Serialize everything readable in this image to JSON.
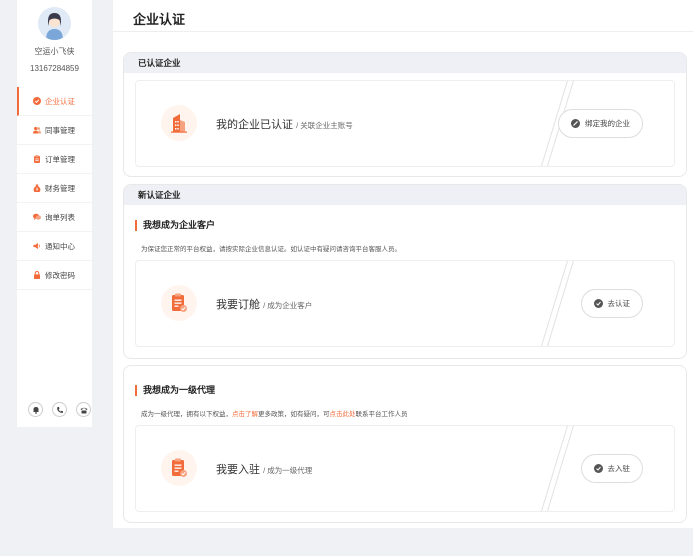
{
  "user": {
    "name": "空运小飞侠",
    "phone": "13167284859"
  },
  "menu": [
    {
      "label": "企业认证",
      "icon": "check-circle-icon",
      "active": true
    },
    {
      "label": "同事管理",
      "icon": "users-icon",
      "active": false
    },
    {
      "label": "订单管理",
      "icon": "clipboard-icon",
      "active": false
    },
    {
      "label": "财务管理",
      "icon": "money-bag-icon",
      "active": false
    },
    {
      "label": "询单列表",
      "icon": "chat-bubble-icon",
      "active": false
    },
    {
      "label": "通知中心",
      "icon": "megaphone-icon",
      "active": false
    },
    {
      "label": "修改密码",
      "icon": "lock-icon",
      "active": false
    }
  ],
  "bottom_icons": [
    "bell-icon",
    "phone-icon",
    "telephone-icon"
  ],
  "page_title": "企业认证",
  "verified": {
    "header": "已认证企业",
    "title": "我的企业已认证",
    "sub": "/ 关联企业主账号",
    "button": "绑定我的企业"
  },
  "new_cert": {
    "header": "新认证企业",
    "section_title": "我想成为企业客户",
    "desc": "为保证您正常的平台权益，请按实际企业信息认证。如认证中有疑问请咨询平台客服人员。",
    "title": "我要订舱",
    "sub": "/ 成为企业客户",
    "button": "去认证"
  },
  "agent": {
    "section_title": "我想成为一级代理",
    "desc_a": "成为一级代理，拥有以下权益，",
    "link_a": "点击了解",
    "desc_b": "更多政策，如有疑问，可",
    "link_b": "点击此处",
    "desc_c": "联系平台工作人员",
    "title": "我要入驻",
    "sub": "/ 成为一级代理",
    "button": "去入驻"
  },
  "colors": {
    "accent": "#f26b3a",
    "header_bg": "#eef0f5",
    "page_bg": "#f0f1f4"
  }
}
